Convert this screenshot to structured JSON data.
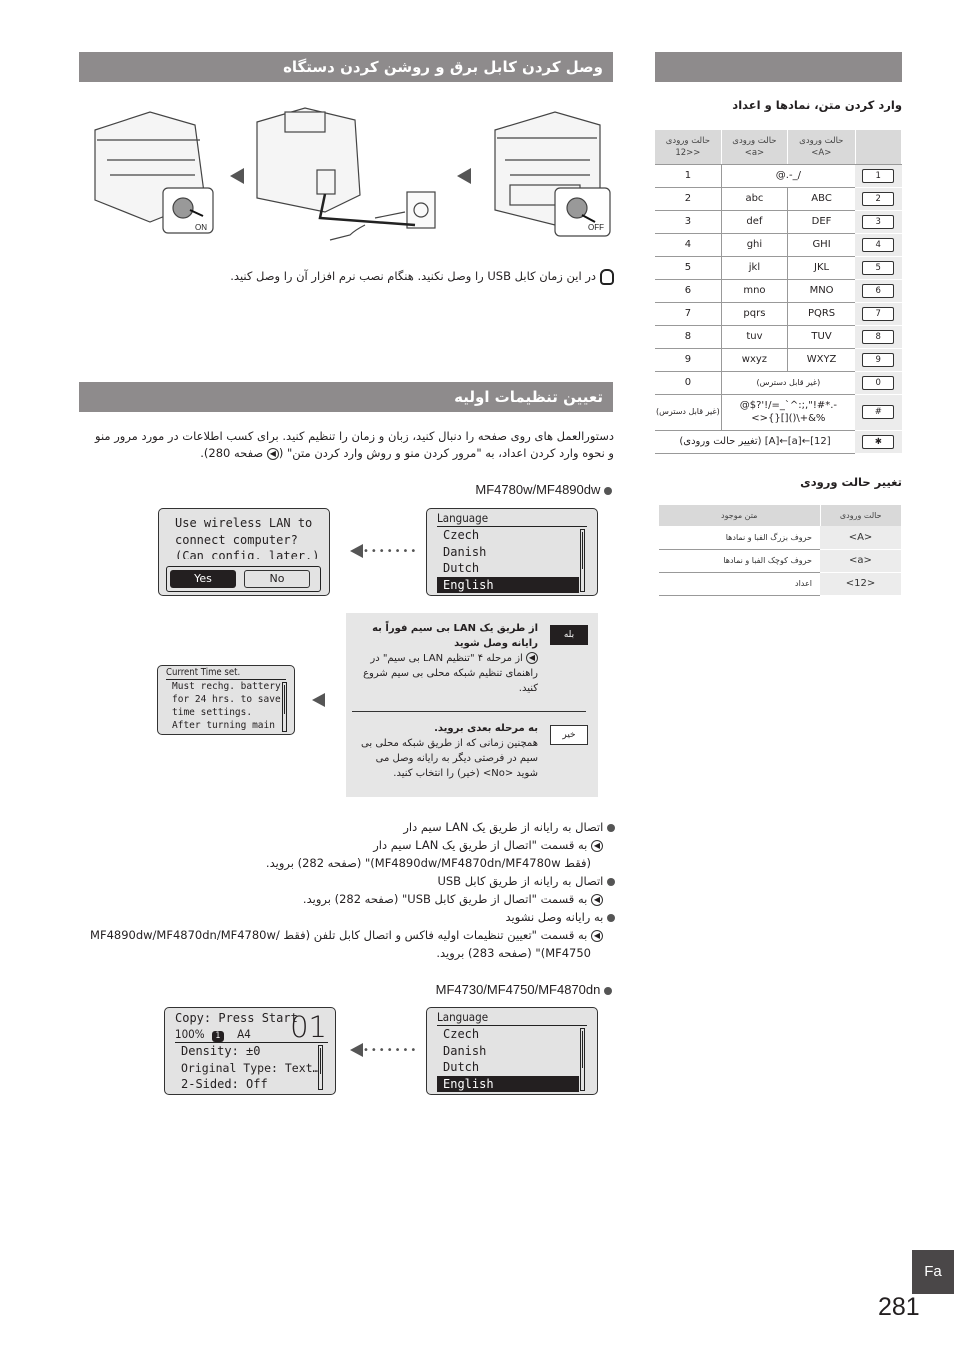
{
  "page": {
    "number": "281",
    "lang_tab": "Fa",
    "accent": "#8e8b8c",
    "tab_bg": "#4a4748"
  },
  "section1": {
    "title": "وصل کردن کابل برق و روشن کردن دستگاه",
    "illustrations": {
      "off_label": "OFF",
      "on_label": "ON"
    },
    "note": "در این زمان کابل USB را وصل نکنید. هنگام نصب نرم افزار آن را وصل کنید."
  },
  "section2": {
    "title": "تعیین تنظیمات اولیه",
    "intro_line1": "دستورالعمل های روی صفحه را دنبال کنید، زبان و زمان را تنظیم کنید. برای کسب اطلاعات در مورد مرور منو",
    "intro_line2": "و نحوه وارد کردن اعداد، به \"مرور کردن منو و روش وارد کردن متن\" (",
    "intro_page": " صفحه 280).",
    "model_group1": "MF4780w/MF4890dw",
    "model_group2": "MF4730/MF4750/MF4870dn",
    "lang_screen": {
      "title": "Language",
      "items": [
        "Czech",
        "Danish",
        "Dutch",
        "English"
      ],
      "selected": "English"
    },
    "wireless_screen": {
      "lines": [
        "Use wireless LAN to",
        "connect computer?",
        "(Can config. later.)"
      ],
      "yes": "Yes",
      "no": "No"
    },
    "time_screen": {
      "title": "Current Time set.",
      "lines": [
        "Must rechg. battery",
        "for 24 hrs. to save",
        "time settings.",
        "After turning main"
      ]
    },
    "copy_screen": {
      "line1": "Copy: Press Start",
      "zoom": "100%",
      "tray": "1",
      "paper": "A4",
      "copies": "01",
      "items": [
        "Density: ±0",
        "Original Type: Text…",
        "2-Sided: Off"
      ]
    },
    "choices": {
      "yes_key": "بله",
      "yes_title": "از طریق یک LAN بی سیم فوراً به رایانه وصل شوید",
      "yes_body": "از مرحله ۴ \"تنظیم LAN بی سیم\" در راهنمای تنظیم شبکه محلی بی سیم شروع کنید.",
      "no_key": "خیر",
      "no_title": "به مرحله بعدی بروید.",
      "no_body": "همچنین زمانی که از طریق شبکه محلی بی سیم در فرصتی دیگر به رایانه وصل می شوید <No> (خیر) را انتخاب کنید."
    },
    "options": [
      {
        "heading": "اتصال به رایانه از طریق یک LAN سیم دار",
        "ref": "به قسمت \"اتصال از طریق یک LAN سیم دار",
        "ref2": "(فقط MF4890dw/MF4870dn/MF4780w)\" (صفحه 282) بروید."
      },
      {
        "heading": "اتصال به رایانه از طریق کابل USB",
        "ref": "به قسمت \"اتصال از طریق کابل USB\" (صفحه 282) بروید.",
        "ref2": ""
      },
      {
        "heading": "به رایانه وصل نشوید",
        "ref": "به قسمت \"تعیین تنظیمات اولیه فاکس و اتصال کابل تلفن (فقط /MF4890dw/MF4870dn/MF4780w",
        "ref2": "MF4750)\" (صفحه 283) بروید."
      }
    ]
  },
  "sidebar": {
    "heading": "وارد کردن متن، نمادها و اعداد",
    "table_headers": [
      "حالت ورودی <A>",
      "حالت ورودی <a>",
      "حالت ورودی <12>"
    ],
    "rows": [
      {
        "key": "1",
        "A": "@.-_/",
        "a": "",
        "n": "1",
        "merged": true
      },
      {
        "key": "2",
        "A": "ABC",
        "a": "abc",
        "n": "2"
      },
      {
        "key": "3",
        "A": "DEF",
        "a": "def",
        "n": "3"
      },
      {
        "key": "4",
        "A": "GHI",
        "a": "ghi",
        "n": "4"
      },
      {
        "key": "5",
        "A": "JKL",
        "a": "jkl",
        "n": "5"
      },
      {
        "key": "6",
        "A": "MNO",
        "a": "mno",
        "n": "6"
      },
      {
        "key": "7",
        "A": "PQRS",
        "a": "pqrs",
        "n": "7"
      },
      {
        "key": "8",
        "A": "TUV",
        "a": "tuv",
        "n": "8"
      },
      {
        "key": "9",
        "A": "WXYZ",
        "a": "wxyz",
        "n": "9"
      },
      {
        "key": "0",
        "A": "(غیر قابل دسترس)",
        "a": "",
        "n": "0",
        "merged": true
      },
      {
        "key": "#",
        "A": "@$?'!/=_`^:;,\"!#*.- <>{}[]()\\+&%",
        "a": "",
        "n": "(غیر قابل دسترس)",
        "merged": true
      },
      {
        "key": "✱",
        "A": "(تغییر حالت ورودی) [A]←[a]←[12]",
        "a": "",
        "n": "",
        "full": true
      }
    ],
    "mode_heading": "تغییر حالت ورودی",
    "mode_headers": [
      "حالت ورودی",
      "متن موجود"
    ],
    "mode_rows": [
      {
        "mode": "<A>",
        "text": "حروف بزرگ الفبا و نمادها"
      },
      {
        "mode": "<a>",
        "text": "حروف کوچک الفبا و نمادها"
      },
      {
        "mode": "<12>",
        "text": "اعداد"
      }
    ]
  }
}
